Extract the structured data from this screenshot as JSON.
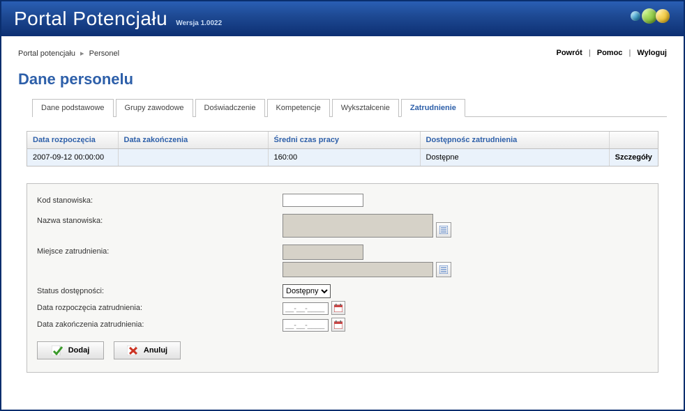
{
  "header": {
    "title": "Portal Potencjału",
    "version": "Wersja 1.0022"
  },
  "breadcrumb": {
    "root": "Portal potencjału",
    "current": "Personel"
  },
  "topLinks": {
    "back": "Powrót",
    "help": "Pomoc",
    "logout": "Wyloguj"
  },
  "pageTitle": "Dane personelu",
  "tabs": {
    "items": [
      {
        "label": "Dane podstawowe",
        "active": false
      },
      {
        "label": "Grupy zawodowe",
        "active": false
      },
      {
        "label": "Doświadczenie",
        "active": false
      },
      {
        "label": "Kompetencje",
        "active": false
      },
      {
        "label": "Wykształcenie",
        "active": false
      },
      {
        "label": "Zatrudnienie",
        "active": true
      }
    ]
  },
  "table": {
    "headers": {
      "start": "Data rozpoczęcia",
      "end": "Data zakończenia",
      "avg": "Średni czas pracy",
      "avail": "Dostępnośc zatrudnienia",
      "details": ""
    },
    "row": {
      "start": "2007-09-12 00:00:00",
      "end": "",
      "avg": "160:00",
      "avail": "Dostępne",
      "details": "Szczegóły"
    }
  },
  "form": {
    "labels": {
      "kod": "Kod stanowiska:",
      "nazwa": "Nazwa stanowiska:",
      "miejsce": "Miejsce zatrudnienia:",
      "status": "Status dostępności:",
      "dataStart": "Data rozpoczęcia zatrudnienia:",
      "dataEnd": "Data zakończenia zatrudnienia:"
    },
    "values": {
      "kod": "",
      "statusSelected": "Dostępny",
      "datePlaceholder": "__-__-____"
    },
    "buttons": {
      "add": "Dodaj",
      "cancel": "Anuluj"
    }
  }
}
